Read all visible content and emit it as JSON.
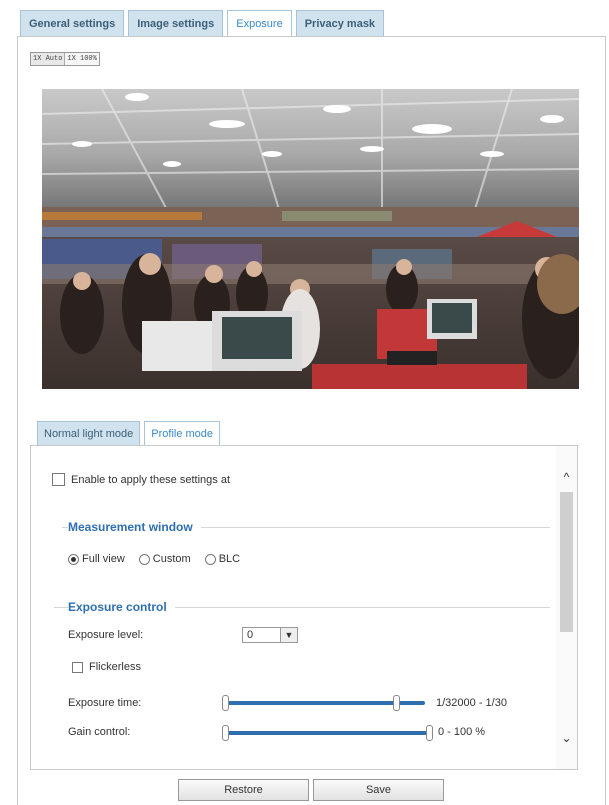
{
  "tabs": [
    {
      "label": "General settings",
      "active": false
    },
    {
      "label": "Image settings",
      "active": false
    },
    {
      "label": "Exposure",
      "active": true
    },
    {
      "label": "Privacy mask",
      "active": false
    }
  ],
  "zoom": {
    "first": "1X Auto",
    "second": "1X 100%"
  },
  "mode_tabs": [
    {
      "label": "Normal light mode",
      "active": false
    },
    {
      "label": "Profile mode",
      "active": true
    }
  ],
  "enable": {
    "label": "Enable to apply these settings at",
    "checked": false
  },
  "measurement": {
    "title": "Measurement window",
    "options": [
      {
        "label": "Full view",
        "checked": true
      },
      {
        "label": "Custom",
        "checked": false
      },
      {
        "label": "BLC",
        "checked": false
      }
    ]
  },
  "exposure": {
    "title": "Exposure control",
    "level_label": "Exposure level:",
    "level_value": "0",
    "flickerless_label": "Flickerless",
    "flickerless_checked": false,
    "time_label": "Exposure time:",
    "time_range": "1/32000 - 1/30",
    "gain_label": "Gain control:",
    "gain_range": "0 - 100 %"
  },
  "buttons": {
    "restore": "Restore",
    "save": "Save"
  },
  "colors": {
    "tab_bg": "#cfe2ee",
    "accent": "#2f6fb0",
    "active_tab_text": "#3a8ad0"
  },
  "icons": {
    "select": "chevron-down-icon",
    "scroll_up": "chevron-up-icon",
    "scroll_down": "chevron-down-icon"
  }
}
